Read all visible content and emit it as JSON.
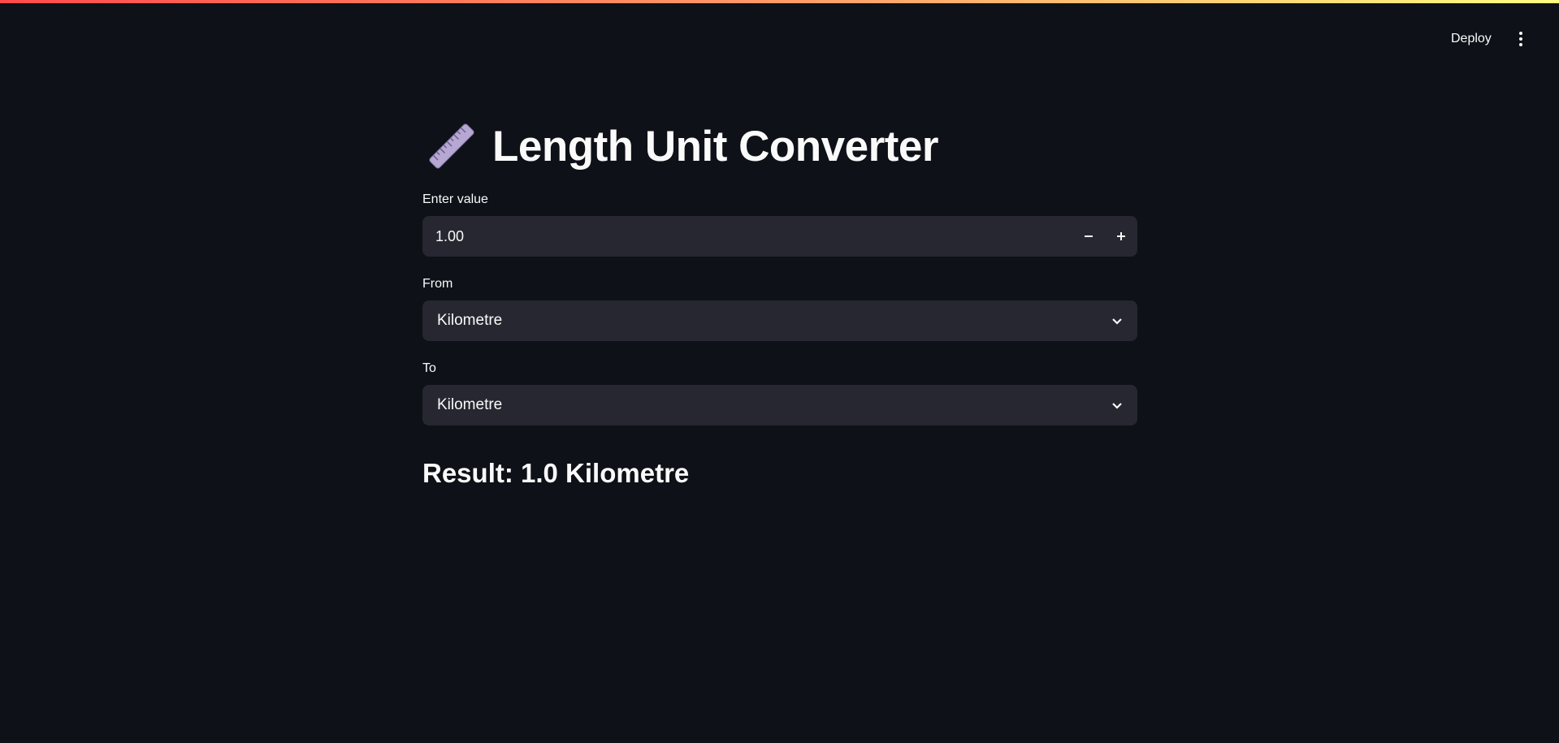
{
  "header": {
    "deploy_label": "Deploy",
    "menu_icon": "kebab-menu-icon"
  },
  "app": {
    "title_icon": "ruler-icon",
    "title": "Length Unit Converter",
    "value_label": "Enter value",
    "value": "1.00",
    "from_label": "From",
    "from_selected": "Kilometre",
    "to_label": "To",
    "to_selected": "Kilometre",
    "result": "Result: 1.0 Kilometre"
  },
  "colors": {
    "background": "#0e1117",
    "input_bg": "#262730",
    "text": "#fafafa",
    "accent_gradient_start": "#ff4b4b",
    "accent_gradient_end": "#fffd80"
  }
}
